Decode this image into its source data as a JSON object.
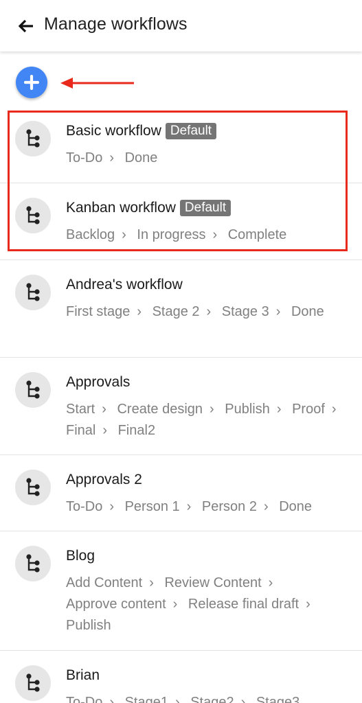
{
  "header": {
    "title": "Manage workflows",
    "back_icon": "arrow-left-icon"
  },
  "add_button": {
    "icon": "plus-icon",
    "color": "#4285f4"
  },
  "annotation": {
    "color": "#e8291c"
  },
  "workflows": [
    {
      "name": "Basic workflow",
      "badge": "Default",
      "stages": [
        "To-Do",
        "Done"
      ]
    },
    {
      "name": "Kanban workflow",
      "badge": "Default",
      "stages": [
        "Backlog",
        "In progress",
        "Complete"
      ]
    },
    {
      "name": "Andrea's workflow",
      "stages": [
        "First stage",
        "Stage 2",
        "Stage 3",
        "Done"
      ]
    },
    {
      "name": "Approvals",
      "stages": [
        "Start",
        "Create design",
        "Publish",
        "Proof",
        "Final",
        "Final2"
      ]
    },
    {
      "name": "Approvals 2",
      "stages": [
        "To-Do",
        "Person 1",
        "Person 2",
        "Done"
      ]
    },
    {
      "name": "Blog",
      "stages": [
        "Add Content",
        "Review Content",
        "Approve content",
        "Release final draft",
        "Publish"
      ]
    },
    {
      "name": "Brian",
      "stages": [
        "To-Do",
        "Stage1",
        "Stage2",
        "Stage3"
      ]
    }
  ]
}
